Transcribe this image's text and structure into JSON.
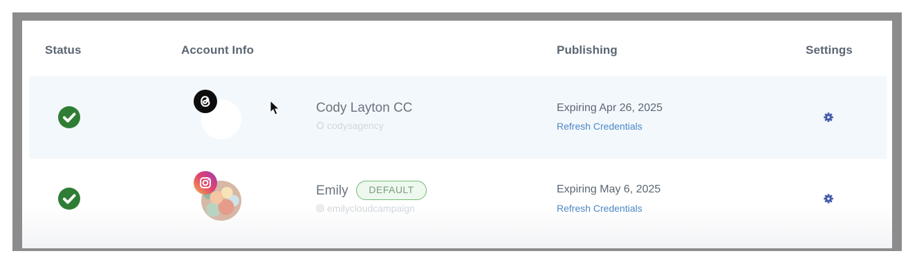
{
  "headers": {
    "status": "Status",
    "account_info": "Account Info",
    "publishing": "Publishing",
    "settings": "Settings"
  },
  "accounts": [
    {
      "status_icon": "check-circle-icon",
      "platform_icon": "threads-icon",
      "name": "Cody Layton CC",
      "handle": "codysagency",
      "is_default": false,
      "expiring": "Expiring Apr 26, 2025",
      "refresh_label": "Refresh Credentials",
      "settings_icon": "gear-icon"
    },
    {
      "status_icon": "check-circle-icon",
      "platform_icon": "instagram-icon",
      "name": "Emily",
      "handle": "emilycloudcampaign",
      "is_default": true,
      "default_label": "DEFAULT",
      "expiring": "Expiring May 6, 2025",
      "refresh_label": "Refresh Credentials",
      "settings_icon": "gear-icon"
    }
  ],
  "colors": {
    "status_ok": "#2f7d35",
    "link": "#4b87c6",
    "default_border": "#6dbb77",
    "row_highlight": "#f3f8fc"
  }
}
